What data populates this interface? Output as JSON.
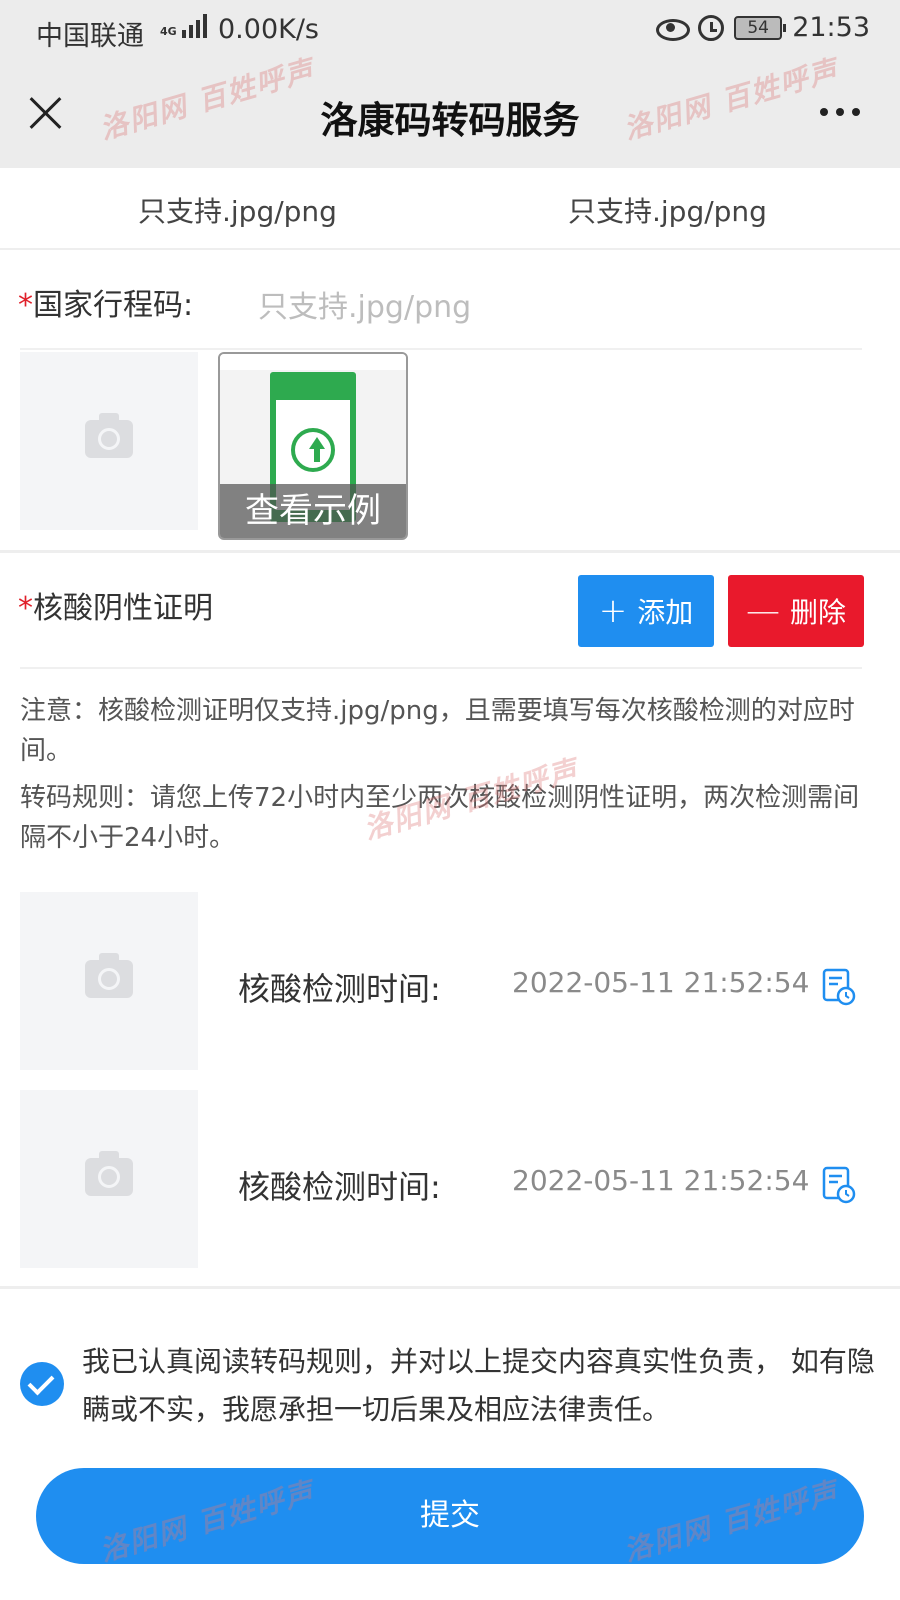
{
  "status_bar": {
    "carrier": "中国联通",
    "network": "4G",
    "speed": "0.00K/s",
    "battery": "54",
    "time": "21:53"
  },
  "header": {
    "title": "洛康码转码服务"
  },
  "watermark": {
    "text_site": "洛阳网",
    "text_tag": "百姓呼声"
  },
  "hint_row": {
    "left": "只支持.jpg/png",
    "right": "只支持.jpg/png"
  },
  "travel_code": {
    "required_mark": "*",
    "label": "国家行程码:",
    "placeholder": "只支持.jpg/png",
    "example_label": "查看示例"
  },
  "nucleic": {
    "required_mark": "*",
    "label": "核酸阴性证明",
    "add_label": "添加",
    "delete_label": "删除",
    "note1": "注意：核酸检测证明仅支持.jpg/png，且需要填写每次核酸检测的对应时间。",
    "note2": "转码规则：请您上传72小时内至少两次核酸检测阴性证明，两次检测需间隔不小于24小时。",
    "entries": [
      {
        "label": "核酸检测时间:",
        "value": "2022-05-11 21:52:54"
      },
      {
        "label": "核酸检测时间:",
        "value": "2022-05-11 21:52:54"
      }
    ]
  },
  "agreement": {
    "checked": true,
    "text": "我已认真阅读转码规则，并对以上提交内容真实性负责， 如有隐瞒或不实，我愿承担一切后果及相应法律责任。"
  },
  "submit": {
    "label": "提交"
  },
  "colors": {
    "primary": "#1f8ef0",
    "danger": "#e9192c",
    "required": "#e0202a"
  }
}
